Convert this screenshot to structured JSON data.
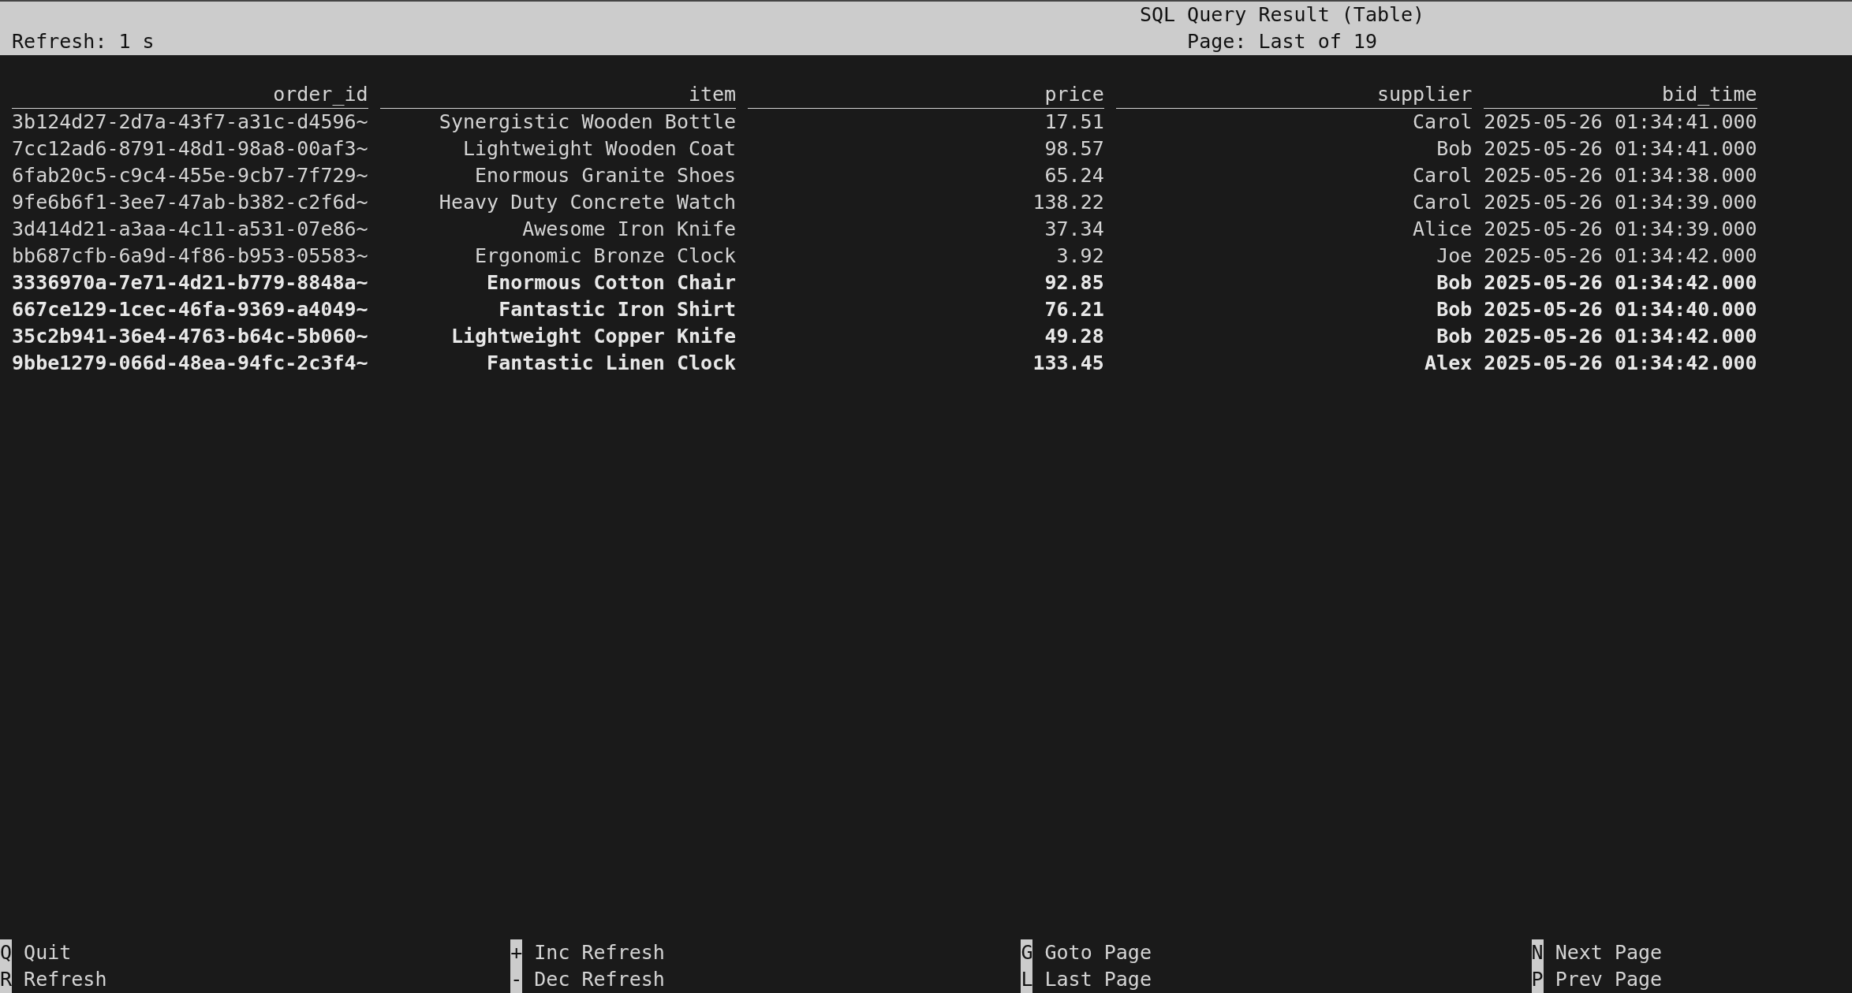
{
  "header": {
    "title": "SQL Query Result (Table)",
    "refresh": "Refresh: 1 s",
    "page": "Page: Last of 19"
  },
  "table": {
    "columns": [
      "order_id",
      "item",
      "price",
      "supplier",
      "bid_time"
    ],
    "rows": [
      {
        "cells": [
          "3b124d27-2d7a-43f7-a31c-d4596~",
          "Synergistic Wooden Bottle",
          "17.51",
          "Carol",
          "2025-05-26 01:34:41.000"
        ],
        "bold": false
      },
      {
        "cells": [
          "7cc12ad6-8791-48d1-98a8-00af3~",
          "Lightweight Wooden Coat",
          "98.57",
          "Bob",
          "2025-05-26 01:34:41.000"
        ],
        "bold": false
      },
      {
        "cells": [
          "6fab20c5-c9c4-455e-9cb7-7f729~",
          "Enormous Granite Shoes",
          "65.24",
          "Carol",
          "2025-05-26 01:34:38.000"
        ],
        "bold": false
      },
      {
        "cells": [
          "9fe6b6f1-3ee7-47ab-b382-c2f6d~",
          "Heavy Duty Concrete Watch",
          "138.22",
          "Carol",
          "2025-05-26 01:34:39.000"
        ],
        "bold": false
      },
      {
        "cells": [
          "3d414d21-a3aa-4c11-a531-07e86~",
          "Awesome Iron Knife",
          "37.34",
          "Alice",
          "2025-05-26 01:34:39.000"
        ],
        "bold": false
      },
      {
        "cells": [
          "bb687cfb-6a9d-4f86-b953-05583~",
          "Ergonomic Bronze Clock",
          "3.92",
          "Joe",
          "2025-05-26 01:34:42.000"
        ],
        "bold": false
      },
      {
        "cells": [
          "3336970a-7e71-4d21-b779-8848a~",
          "Enormous Cotton Chair",
          "92.85",
          "Bob",
          "2025-05-26 01:34:42.000"
        ],
        "bold": true
      },
      {
        "cells": [
          "667ce129-1cec-46fa-9369-a4049~",
          "Fantastic Iron Shirt",
          "76.21",
          "Bob",
          "2025-05-26 01:34:40.000"
        ],
        "bold": true
      },
      {
        "cells": [
          "35c2b941-36e4-4763-b64c-5b060~",
          "Lightweight Copper Knife",
          "49.28",
          "Bob",
          "2025-05-26 01:34:42.000"
        ],
        "bold": true
      },
      {
        "cells": [
          "9bbe1279-066d-48ea-94fc-2c3f4~",
          "Fantastic Linen Clock",
          "133.45",
          "Alex",
          "2025-05-26 01:34:42.000"
        ],
        "bold": true
      }
    ]
  },
  "shortcuts": [
    {
      "key": "Q",
      "label": "Quit"
    },
    {
      "key": "+",
      "label": "Inc Refresh"
    },
    {
      "key": "G",
      "label": "Goto Page"
    },
    {
      "key": "N",
      "label": "Next Page"
    },
    {
      "key": "R",
      "label": "Refresh"
    },
    {
      "key": "-",
      "label": "Dec Refresh"
    },
    {
      "key": "L",
      "label": "Last Page"
    },
    {
      "key": "P",
      "label": "Prev Page"
    }
  ]
}
